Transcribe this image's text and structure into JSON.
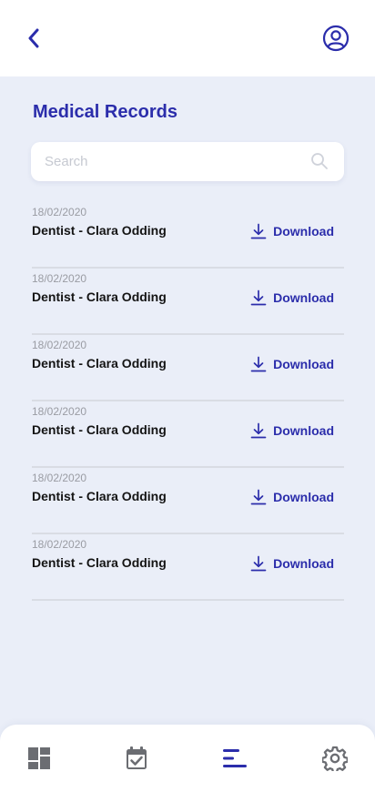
{
  "header": {
    "back_icon": "chevron-left-icon",
    "profile_icon": "user-circle-icon"
  },
  "page": {
    "title": "Medical Records"
  },
  "search": {
    "placeholder": "Search",
    "value": "",
    "icon": "search-icon"
  },
  "records": [
    {
      "date": "18/02/2020",
      "title": "Dentist - Clara Odding",
      "action_label": "Download"
    },
    {
      "date": "18/02/2020",
      "title": "Dentist - Clara Odding",
      "action_label": "Download"
    },
    {
      "date": "18/02/2020",
      "title": "Dentist - Clara Odding",
      "action_label": "Download"
    },
    {
      "date": "18/02/2020",
      "title": "Dentist - Clara Odding",
      "action_label": "Download"
    },
    {
      "date": "18/02/2020",
      "title": "Dentist - Clara Odding",
      "action_label": "Download"
    },
    {
      "date": "18/02/2020",
      "title": "Dentist - Clara Odding",
      "action_label": "Download"
    }
  ],
  "bottom_nav": {
    "items": [
      {
        "icon": "dashboard-icon",
        "active": false
      },
      {
        "icon": "calendar-check-icon",
        "active": false
      },
      {
        "icon": "records-list-icon",
        "active": true
      },
      {
        "icon": "gear-icon",
        "active": false
      }
    ]
  },
  "colors": {
    "accent": "#2b2dab",
    "background": "#eaeef8",
    "inactive_icon": "#6b6d72"
  }
}
